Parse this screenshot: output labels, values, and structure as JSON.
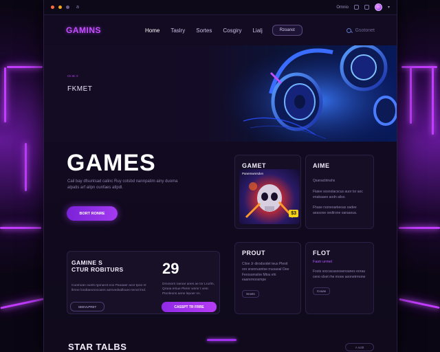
{
  "chrome": {
    "tab_label": "a",
    "right_label": "Omnio",
    "colors": {
      "red": "#ff6b3d",
      "yellow": "#f3a81a",
      "green": "#6a5a8a"
    }
  },
  "nav": {
    "logo": "GAMINS",
    "links": [
      "Home",
      "Taslry",
      "Sortes",
      "Cosgiry",
      "Lialj"
    ],
    "button": "Rzoanst",
    "search_placeholder": "Gsotonet"
  },
  "hero": {
    "kicker": "cs ac s",
    "subtitle": "FKMET"
  },
  "main": {
    "title": "GAMES",
    "description": "Cail bay dfsuntsad calinc Ruy cotsbd nannpatim ainy duoma alpatis arf ailpn ounfaes atlpdl.",
    "cta": "BORT RONRE"
  },
  "cards": [
    {
      "title": "GAMET",
      "art_subtitle": "Panemwnrsdvn",
      "price": "$3"
    },
    {
      "title": "AIME",
      "label": "",
      "text_1": "Qsanacbtnahs",
      "text_2": "Flaiee sosnolacscus auor tsr aoc enabaaee aodn ailso.",
      "text_3": "Fhase rsoneoarkeoas oadee aeasooe oedtrone oaraaoua."
    },
    {
      "title": "PROUT",
      "label": "",
      "text": "Clioe Jr dirodsodet teus Pleoit oro snsnnuontse rnusaoal Oee Ferosomsitre Mtos ehi eaarernoosmpe",
      "chip": "Srosts"
    },
    {
      "title": "FLOT",
      "label": "Fastr urmet",
      "text": "Fosts soccacasoosenoanes eoraa ceno olxet rhe mooe aoonetrrnone",
      "chip": "Cooas"
    }
  ],
  "stats": {
    "title_line1": "GAMINE S",
    "title_line2": "CTUR ROBITURS",
    "text": "Cuomoan ounts rgonarot eoo Paoaaer acor tpoo nt llrnne loodtaeonocoans aomvedsalloueo tenot lmd.",
    "number": "29",
    "text2": "Dmosors raeoar anes ae tor Lrurlm, Qraoa ersue Plerer wnmr t vesr. Ptonleons aene lepoer nn.",
    "button_outline": "SEEVLPRET",
    "button_solid": "CASSPT TR FRRE"
  },
  "bottom": {
    "heading": "STAR TALBS",
    "pill": "A sottt"
  }
}
